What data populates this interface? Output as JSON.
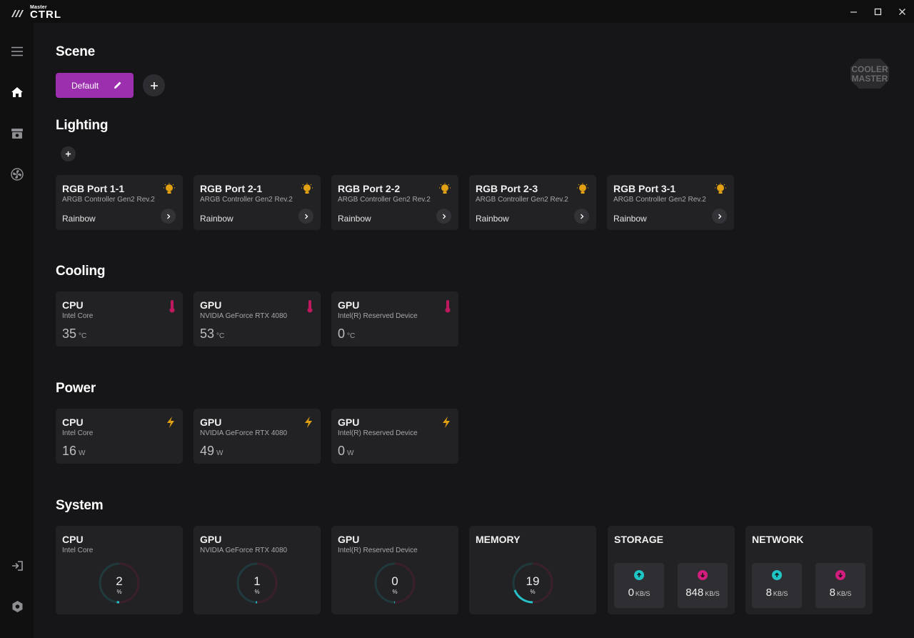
{
  "app": {
    "brand_small": "Master",
    "brand_big": "CTRL"
  },
  "window_controls": {
    "minimize": "—",
    "maximize": "☐",
    "close": "✕"
  },
  "sections": {
    "scene": "Scene",
    "lighting": "Lighting",
    "cooling": "Cooling",
    "power": "Power",
    "system": "System"
  },
  "scene": {
    "active": "Default"
  },
  "colors": {
    "accent": "#9b2fae",
    "bulb": "#e0a012",
    "thermo": "#c0185f",
    "bolt": "#e0a012",
    "upload": "#1fc4c4",
    "download": "#d11d7e"
  },
  "lighting": [
    {
      "title": "RGB Port 1-1",
      "sub": "ARGB Controller Gen2 Rev.2",
      "mode": "Rainbow"
    },
    {
      "title": "RGB Port 2-1",
      "sub": "ARGB Controller Gen2 Rev.2",
      "mode": "Rainbow"
    },
    {
      "title": "RGB Port 2-2",
      "sub": "ARGB Controller Gen2 Rev.2",
      "mode": "Rainbow"
    },
    {
      "title": "RGB Port 2-3",
      "sub": "ARGB Controller Gen2 Rev.2",
      "mode": "Rainbow"
    },
    {
      "title": "RGB Port 3-1",
      "sub": "ARGB Controller Gen2 Rev.2",
      "mode": "Rainbow"
    }
  ],
  "cooling": [
    {
      "title": "CPU",
      "sub": "Intel Core",
      "value": "35",
      "unit": "°C"
    },
    {
      "title": "GPU",
      "sub": "NVIDIA GeForce RTX 4080",
      "value": "53",
      "unit": "°C"
    },
    {
      "title": "GPU",
      "sub": "Intel(R) Reserved Device",
      "value": "0",
      "unit": "°C"
    }
  ],
  "power": [
    {
      "title": "CPU",
      "sub": "Intel Core",
      "value": "16",
      "unit": "W"
    },
    {
      "title": "GPU",
      "sub": "NVIDIA GeForce RTX 4080",
      "value": "49",
      "unit": "W"
    },
    {
      "title": "GPU",
      "sub": "Intel(R) Reserved Device",
      "value": "0",
      "unit": "W"
    }
  ],
  "system": {
    "usage": [
      {
        "title": "CPU",
        "sub": "Intel Core",
        "value": "2",
        "unit": "%"
      },
      {
        "title": "GPU",
        "sub": "NVIDIA GeForce RTX 4080",
        "value": "1",
        "unit": "%"
      },
      {
        "title": "GPU",
        "sub": "Intel(R) Reserved Device",
        "value": "0",
        "unit": "%"
      },
      {
        "title": "MEMORY",
        "sub": "",
        "value": "19",
        "unit": "%"
      }
    ],
    "storage": {
      "title": "STORAGE",
      "up": "0",
      "down": "848",
      "unit": "KB/S"
    },
    "network": {
      "title": "NETWORK",
      "up": "8",
      "down": "8",
      "unit": "KB/S"
    }
  }
}
